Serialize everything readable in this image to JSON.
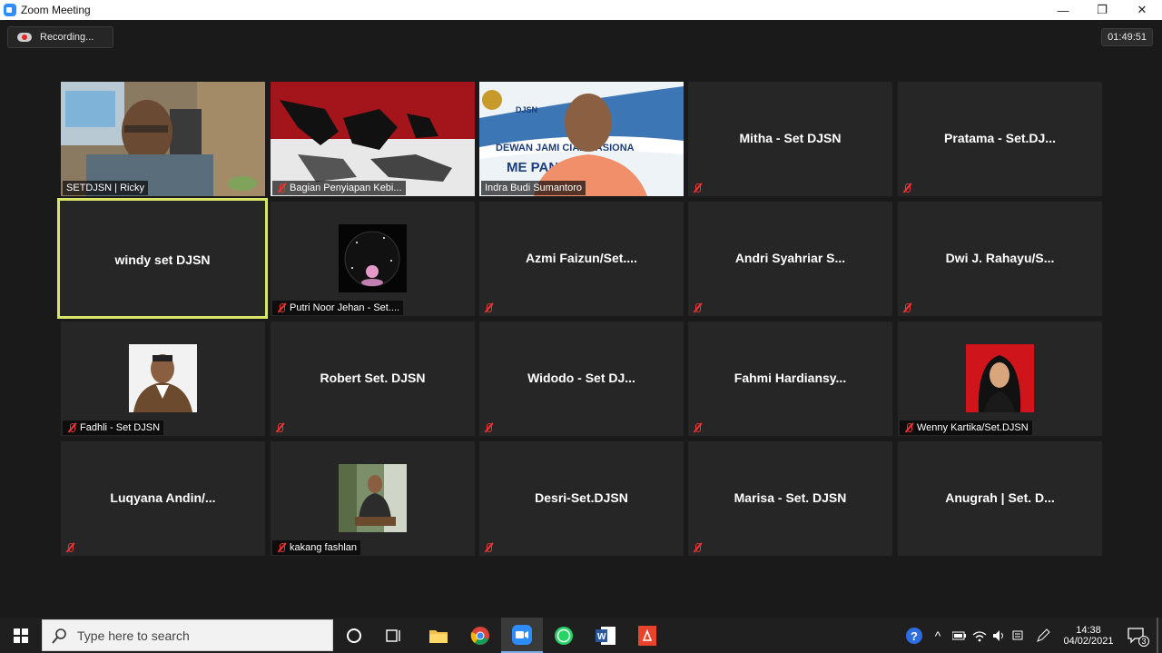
{
  "window": {
    "title": "Zoom Meeting"
  },
  "meeting": {
    "recording_label": "Recording...",
    "elapsed": "01:49:51"
  },
  "participants": [
    {
      "name": "SETDJSN | Ricky",
      "video": true,
      "scene": "office-man",
      "muted": false
    },
    {
      "name": "Bagian Penyiapan Kebi...",
      "video": true,
      "scene": "flag-map",
      "muted": true
    },
    {
      "name": "Indra Budi Sumantoro",
      "video": true,
      "scene": "djsn-banner",
      "muted": false,
      "banner_top": "DJSN",
      "banner_mid": "DEWAN JAMI      CIAL NASIONA",
      "banner_low": "ME          PAN"
    },
    {
      "display": "Mitha - Set DJSN",
      "video": false,
      "muted": true
    },
    {
      "display": "Pratama - Set.DJ...",
      "video": false,
      "muted": true
    },
    {
      "display": "windy set DJSN",
      "video": false,
      "muted": false,
      "active_speaker": true
    },
    {
      "name": "Putri Noor Jehan - Set....",
      "video": false,
      "avatar": "galaxy",
      "muted": true
    },
    {
      "display": "Azmi  Faizun/Set....",
      "video": false,
      "muted": true
    },
    {
      "display": "Andri  Syahriar  S...",
      "video": false,
      "muted": true
    },
    {
      "display": "Dwi  J.  Rahayu/S...",
      "video": false,
      "muted": true
    },
    {
      "name": "Fadhli - Set DJSN",
      "video": false,
      "avatar": "man-batik",
      "muted": true
    },
    {
      "display": "Robert Set. DJSN",
      "video": false,
      "muted": true
    },
    {
      "display": "Widodo  -  Set  DJ...",
      "video": false,
      "muted": true
    },
    {
      "display": "Fahmi  Hardiansy...",
      "video": false,
      "muted": true
    },
    {
      "name": "Wenny Kartika/Set.DJSN",
      "video": false,
      "avatar": "woman-hijab",
      "muted": true
    },
    {
      "display": "Luqyana  Andin/...",
      "video": false,
      "muted": true
    },
    {
      "name": "kakang fashlan",
      "video": false,
      "avatar": "man-chair",
      "muted": true
    },
    {
      "display": "Desri-Set.DJSN",
      "video": false,
      "muted": true
    },
    {
      "display": "Marisa  -  Set.  DJSN",
      "video": false,
      "muted": true
    },
    {
      "display": "Anugrah  |  Set.  D...",
      "video": false,
      "muted": false
    }
  ],
  "taskbar": {
    "search_placeholder": "Type here to search",
    "time": "14:38",
    "date": "04/02/2021",
    "notification_count": "3"
  },
  "colors": {
    "tile_bg": "#262626",
    "active_border": "#d9e66a",
    "mute_red": "#e33333"
  }
}
